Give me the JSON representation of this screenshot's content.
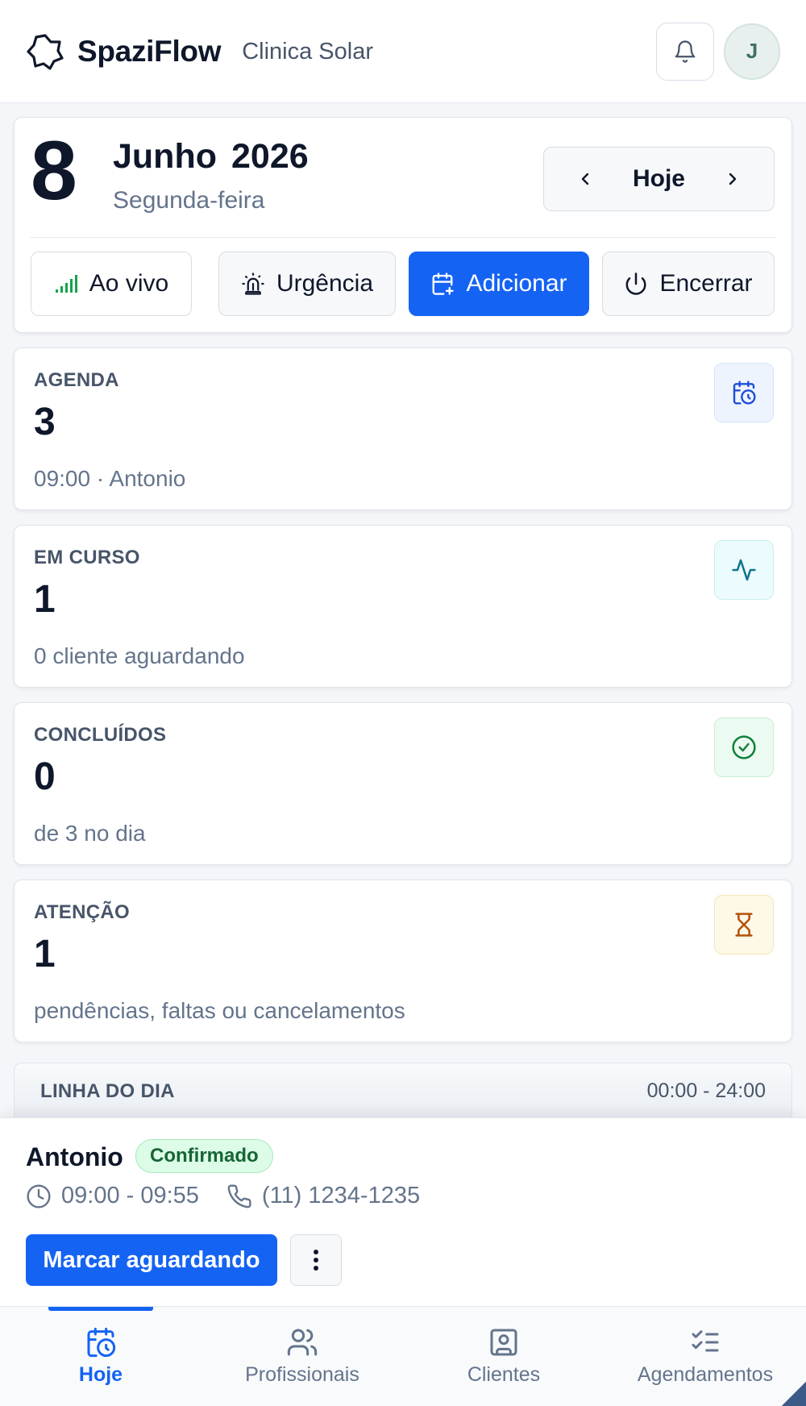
{
  "header": {
    "brand": "SpaziFlow",
    "clinic": "Clinica Solar",
    "avatar_initial": "J"
  },
  "date_card": {
    "day": "8",
    "month": "Junho",
    "year": "2026",
    "weekday": "Segunda-feira",
    "nav_today": "Hoje",
    "actions": {
      "live": "Ao vivo",
      "urgency": "Urgência",
      "add": "Adicionar",
      "close": "Encerrar"
    }
  },
  "stats": [
    {
      "label": "AGENDA",
      "value": "3",
      "sub": "09:00 · Antonio",
      "icon": "calendar-clock-icon",
      "icon_bg": "#eef4fe",
      "icon_color": "#1d4ed8"
    },
    {
      "label": "EM CURSO",
      "value": "1",
      "sub": "0 cliente aguardando",
      "icon": "activity-icon",
      "icon_bg": "#ecfbfd",
      "icon_color": "#0e7490"
    },
    {
      "label": "CONCLUÍDOS",
      "value": "0",
      "sub": "de 3 no dia",
      "icon": "check-circle-icon",
      "icon_bg": "#ecfbf2",
      "icon_color": "#15803d"
    },
    {
      "label": "ATENÇÃO",
      "value": "1",
      "sub": "pendências, faltas ou cancelamentos",
      "icon": "hourglass-icon",
      "icon_bg": "#fef8e7",
      "icon_color": "#b45309"
    }
  ],
  "timeline": {
    "title": "LINHA DO DIA",
    "range": "00:00 - 24:00"
  },
  "appointment": {
    "client": "Antonio",
    "status": "Confirmado",
    "time": "09:00 - 09:55",
    "phone": "(11) 1234-1235",
    "primary_action": "Marcar aguardando"
  },
  "bottom_nav": [
    {
      "label": "Hoje",
      "icon": "calendar-clock-icon",
      "active": true
    },
    {
      "label": "Profissionais",
      "icon": "users-icon",
      "active": false
    },
    {
      "label": "Clientes",
      "icon": "contact-icon",
      "active": false
    },
    {
      "label": "Agendamentos",
      "icon": "list-checks-icon",
      "active": false
    }
  ],
  "colors": {
    "accent": "#1463f3",
    "status_confirmed_bg": "#dcfce7",
    "status_confirmed_text": "#166534"
  }
}
